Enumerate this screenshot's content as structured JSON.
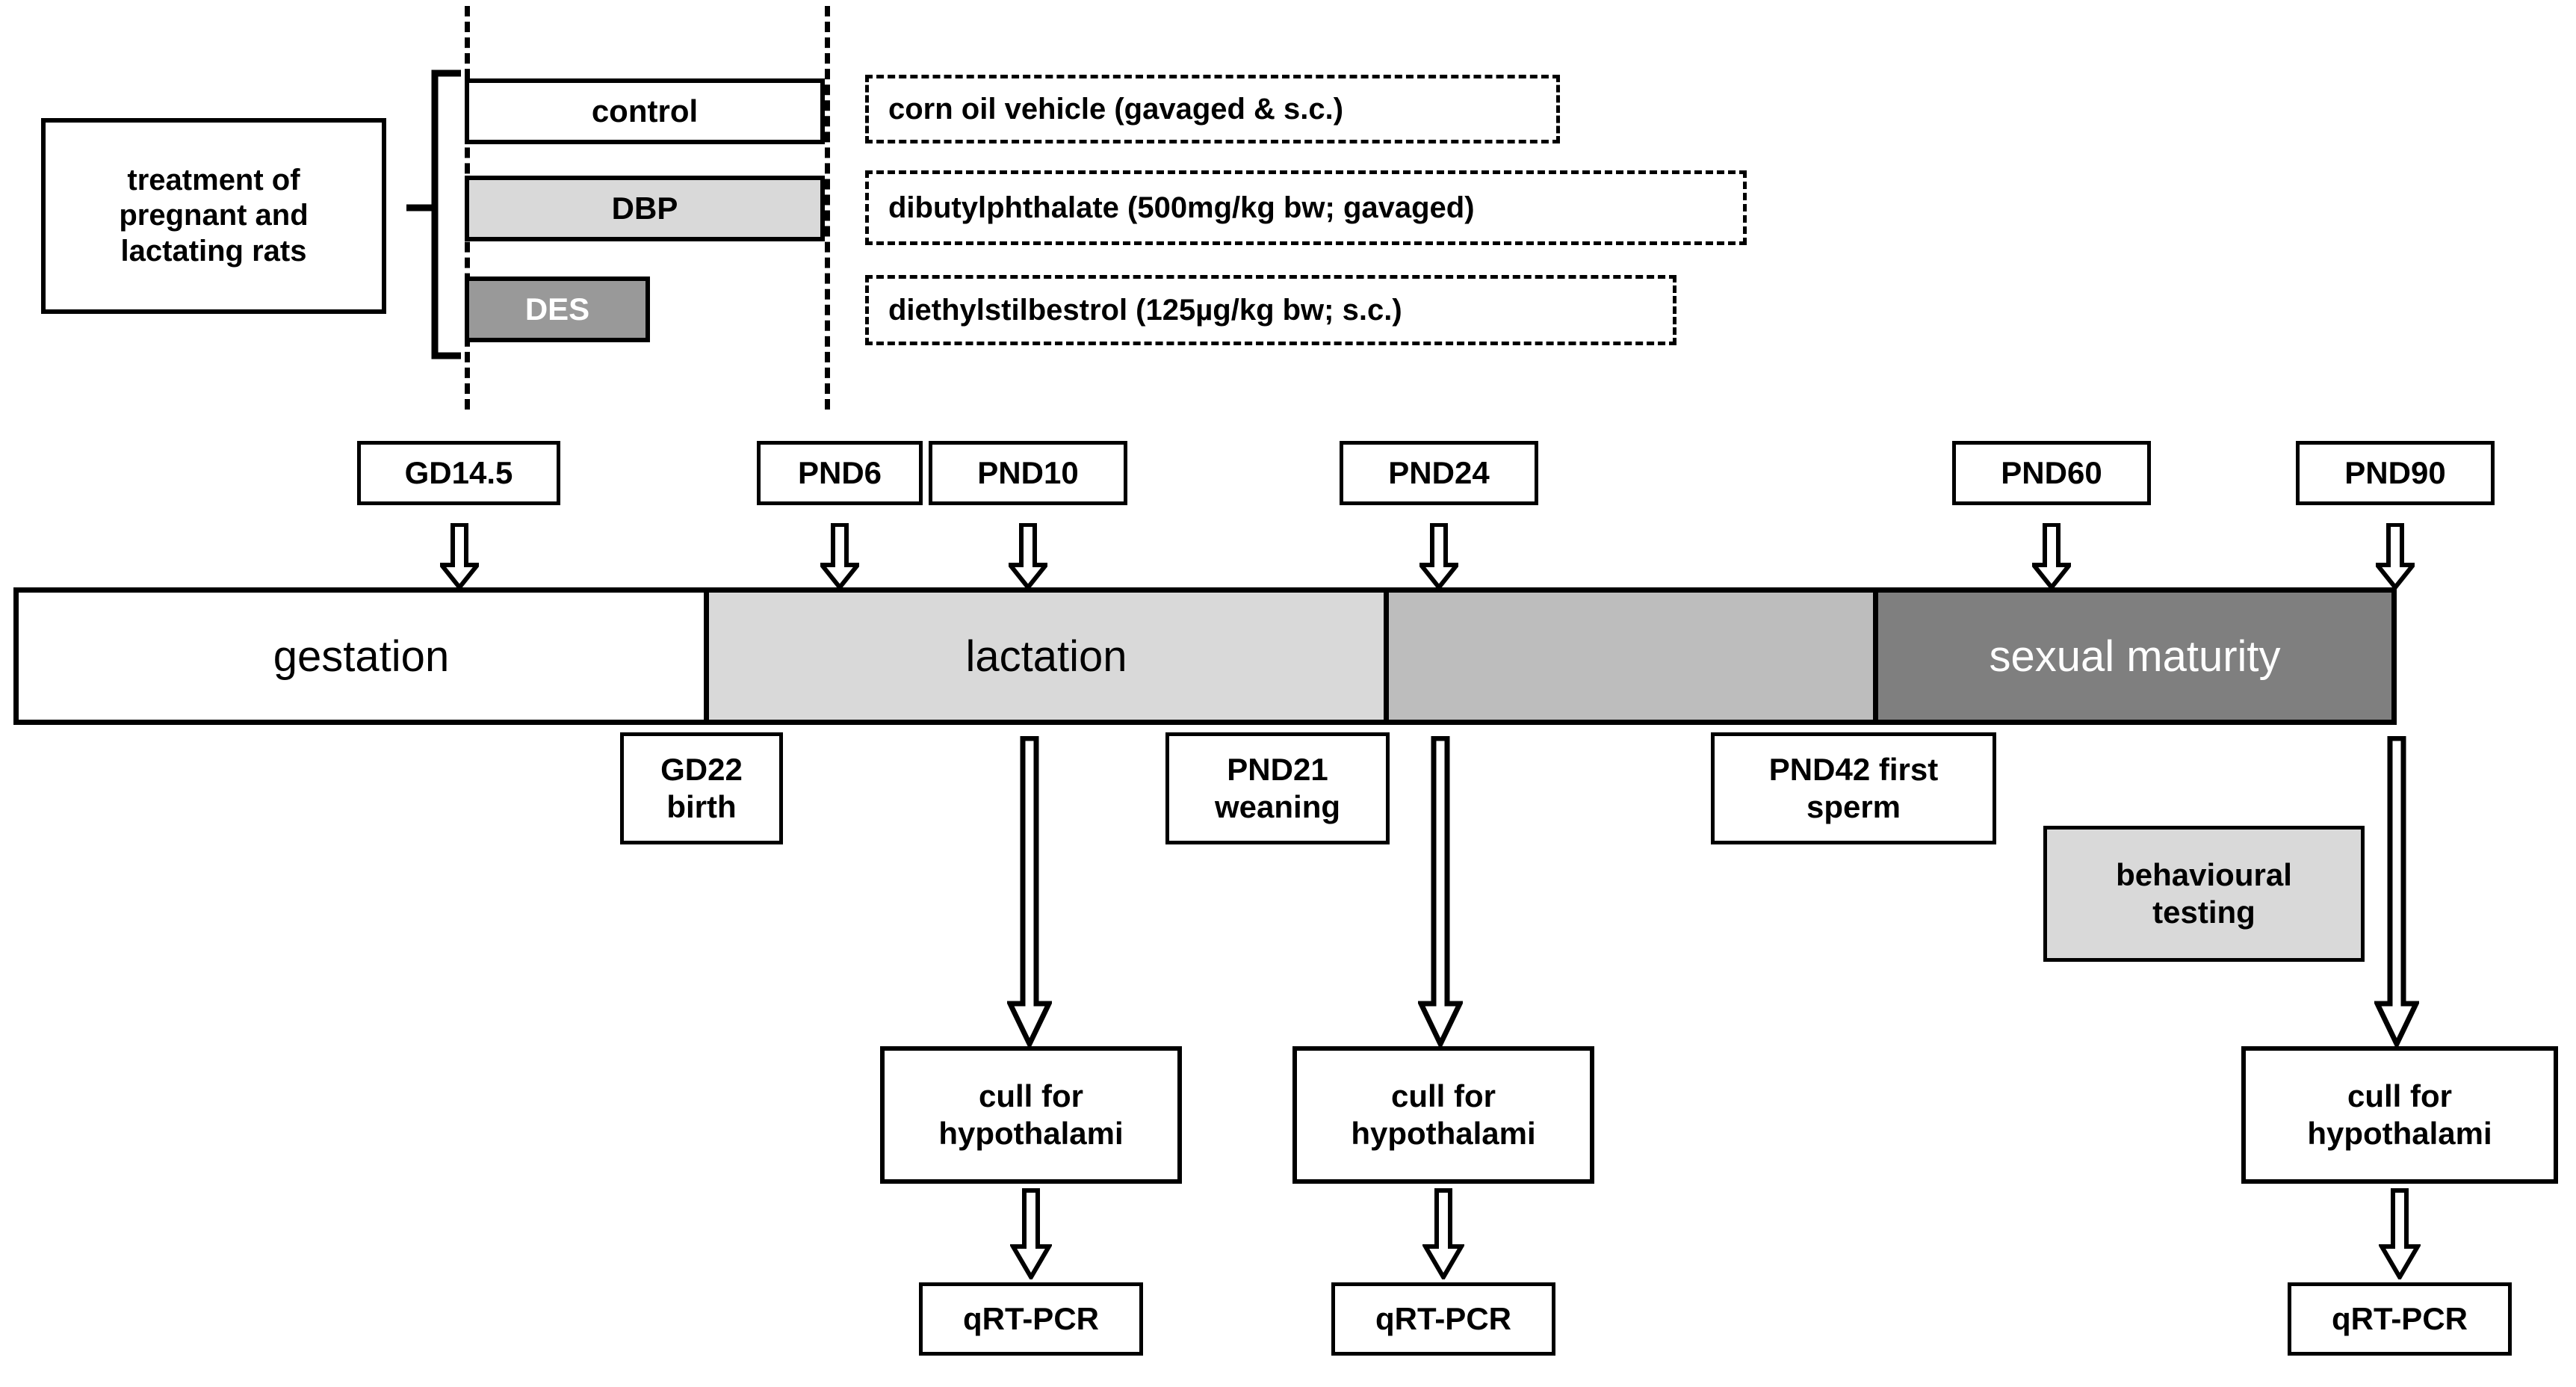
{
  "treatment_group": {
    "label_box": "treatment of pregnant and lactating rats",
    "label_lines": [
      "treatment of",
      "pregnant and",
      "lactating rats"
    ],
    "bars": [
      {
        "name": "control",
        "label": "control",
        "fill": "#ffffff",
        "text_color": "#000000"
      },
      {
        "name": "dbp",
        "label": "DBP",
        "fill": "#d9d9d9",
        "text_color": "#000000"
      },
      {
        "name": "des",
        "label": "DES",
        "fill": "#999999",
        "text_color": "#ffffff"
      }
    ],
    "descriptions": [
      "corn oil vehicle (gavaged & s.c.)",
      "dibutylphthalate (500mg/kg bw; gavaged)",
      "diethylstilbestrol (125µg/kg bw; s.c.)"
    ]
  },
  "timepoints_above": [
    {
      "label": "GD14.5"
    },
    {
      "label": "PND6"
    },
    {
      "label": "PND10"
    },
    {
      "label": "PND24"
    },
    {
      "label": "PND60"
    },
    {
      "label": "PND90"
    }
  ],
  "timeline": {
    "segments": [
      {
        "name": "gestation",
        "label": "gestation",
        "fill": "#ffffff",
        "text_color": "#000000"
      },
      {
        "name": "lactation",
        "label": "lactation",
        "fill": "#d9d9d9",
        "text_color": "#000000"
      },
      {
        "name": "juvenile",
        "label": "",
        "fill": "#bdbdbd",
        "text_color": "#000000"
      },
      {
        "name": "sexual-maturity",
        "label": "sexual maturity",
        "fill": "#7f7f7f",
        "text_color": "#ffffff"
      }
    ]
  },
  "events_below": [
    {
      "name": "gd22-birth",
      "lines": [
        "GD22",
        "birth"
      ]
    },
    {
      "name": "pnd21-weaning",
      "lines": [
        "PND21",
        "weaning"
      ]
    },
    {
      "name": "pnd42-first-sperm",
      "lines": [
        "PND42 first",
        "sperm"
      ]
    },
    {
      "name": "behavioural-testing",
      "lines": [
        "behavioural",
        "testing"
      ],
      "fill": "#d9d9d9"
    }
  ],
  "workflow": {
    "cull_lines": [
      "cull for",
      "hypothalami"
    ],
    "assay_label": "qRT-PCR",
    "columns": [
      {
        "name": "pnd10-branch",
        "source": "PND10"
      },
      {
        "name": "pnd24-branch",
        "source": "PND24"
      },
      {
        "name": "pnd90-branch",
        "source": "PND90"
      }
    ]
  },
  "colors": {
    "outline": "#000000",
    "light_gray": "#d9d9d9",
    "mid_gray": "#bdbdbd",
    "dark_gray": "#7f7f7f",
    "background": "#ffffff"
  }
}
